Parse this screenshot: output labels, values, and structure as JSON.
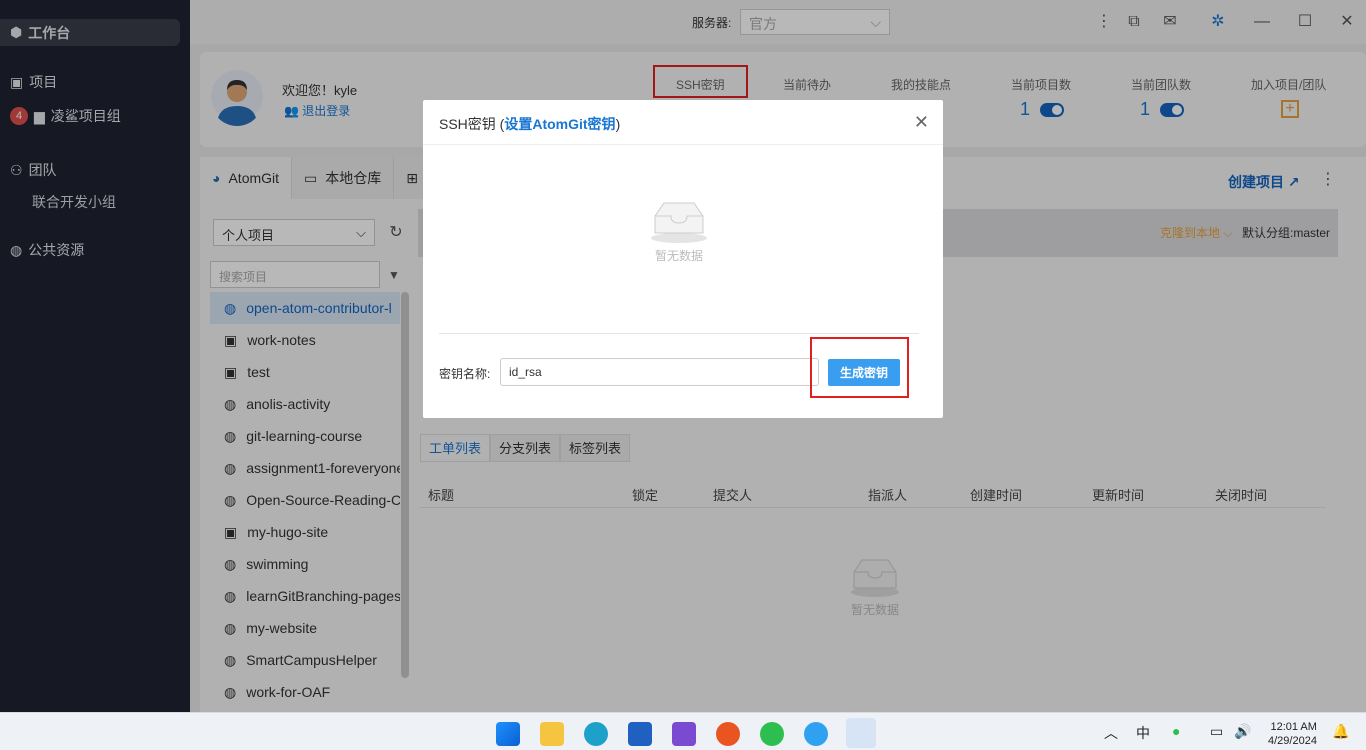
{
  "sidebar": {
    "workbench": "工作台",
    "projects": "项目",
    "group_badge": "4",
    "group": "凌鲨项目组",
    "team": "团队",
    "team_sub": "联合开发小组",
    "public": "公共资源"
  },
  "topbar": {
    "server_label": "服务器:",
    "server_value": "官方"
  },
  "header": {
    "welcome": "欢迎您！kyle",
    "logout": "退出登录",
    "stats": [
      "SSH密钥",
      "当前待办",
      "我的技能点",
      "当前项目数",
      "当前团队数",
      "加入项目/团队"
    ],
    "project_count": "1",
    "team_count": "1"
  },
  "tabs": {
    "atomgit": "AtomGit",
    "local_repo": "本地仓库",
    "create_project": "创建项目"
  },
  "repo": {
    "clone": "克隆到本地",
    "default_branch": "默认分组:master",
    "select": "个人项目",
    "search_placeholder": "搜索项目",
    "items": [
      "open-atom-contributor-l",
      "work-notes",
      "test",
      "anolis-activity",
      "git-learning-course",
      "assignment1-foreveryone",
      "Open-Source-Reading-C",
      "my-hugo-site",
      "swimming",
      "learnGitBranching-pages",
      "my-website",
      "SmartCampusHelper",
      "work-for-OAF"
    ]
  },
  "subtabs": [
    "工单列表",
    "分支列表",
    "标签列表"
  ],
  "table": {
    "headers": [
      "标题",
      "锁定",
      "提交人",
      "指派人",
      "创建时间",
      "更新时间",
      "关闭时间"
    ],
    "empty": "暂无数据"
  },
  "modal": {
    "title": "SSH密钥 (",
    "title_link": "设置AtomGit密钥",
    "title_end": ")",
    "empty": "暂无数据",
    "key_label": "密钥名称:",
    "key_value": "id_rsa",
    "generate": "生成密钥"
  },
  "taskbar": {
    "ime": "中",
    "time": "12:01 AM",
    "date": "4/29/2024"
  }
}
